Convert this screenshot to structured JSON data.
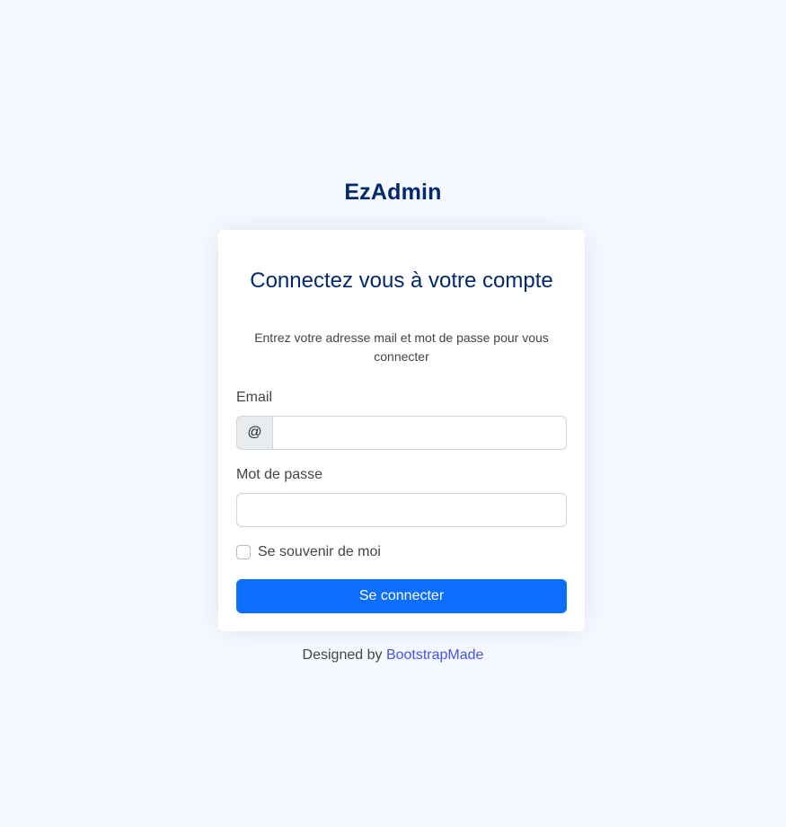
{
  "brand": {
    "name": "EzAdmin"
  },
  "login": {
    "title": "Connectez vous à votre compte",
    "subtitle": "Entrez votre adresse mail et mot de passe pour vous connecter",
    "email_label": "Email",
    "email_addon": "@",
    "email_value": "",
    "password_label": "Mot de passe",
    "password_value": "",
    "remember_label": "Se souvenir de moi",
    "remember_checked": false,
    "submit_label": "Se connecter"
  },
  "footer": {
    "prefix": "Designed by",
    "link_text": "BootstrapMade"
  },
  "colors": {
    "background": "#f6f9ff",
    "brand": "#012970",
    "primary_button": "#0d6efd",
    "link": "#4154f1"
  }
}
